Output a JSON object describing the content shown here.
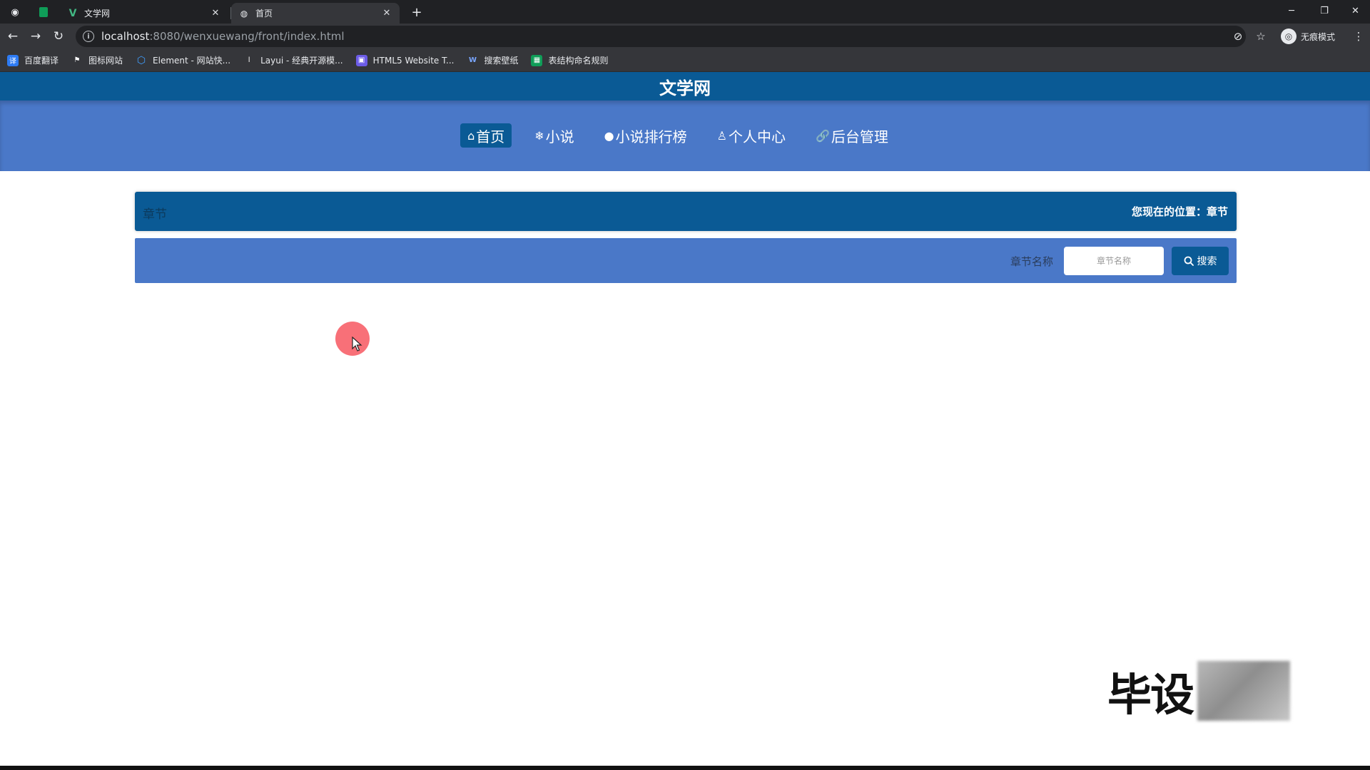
{
  "browser": {
    "tabs": [
      {
        "title": "文学网",
        "active": false
      },
      {
        "title": "首页",
        "active": true
      }
    ],
    "new_tab_label": "+",
    "url_host": "localhost",
    "url_rest": ":8080/wenxuewang/front/index.html",
    "profile_label": "无痕模式",
    "bookmarks": [
      {
        "label": "百度翻译",
        "color": "#2d7bf4",
        "glyph": "译"
      },
      {
        "label": "图标网站",
        "color": "#35363a",
        "glyph": "⚑"
      },
      {
        "label": "Element - 网站快...",
        "color": "#409eff",
        "glyph": "⬡"
      },
      {
        "label": "Layui - 经典开源模...",
        "color": "#35363a",
        "glyph": "l"
      },
      {
        "label": "HTML5 Website T...",
        "color": "#6c5ce7",
        "glyph": "▣"
      },
      {
        "label": "搜索壁纸",
        "color": "#35363a",
        "glyph": "W"
      },
      {
        "label": "表结构命名规则",
        "color": "#0f9d58",
        "glyph": "▦"
      }
    ]
  },
  "site": {
    "title": "文学网",
    "nav": [
      {
        "icon": "⌂",
        "icon_name": "home-icon",
        "label": "首页",
        "active": true
      },
      {
        "icon": "❄",
        "icon_name": "snowflake-icon",
        "label": "小说",
        "active": false
      },
      {
        "icon": "●",
        "icon_name": "globe-icon",
        "label": "小说排行榜",
        "active": false
      },
      {
        "icon": "♙",
        "icon_name": "user-icon",
        "label": "个人中心",
        "active": false
      },
      {
        "icon": "🔗",
        "icon_name": "link-icon",
        "label": "后台管理",
        "active": false
      }
    ],
    "breadcrumb": {
      "left": "章节",
      "right": "您现在的位置：章节"
    },
    "search": {
      "label": "章节名称",
      "placeholder": "章节名称",
      "value": "",
      "button": "搜索"
    }
  },
  "watermark": {
    "text": "毕设"
  },
  "colors": {
    "header": "#0a5a95",
    "nav_band": "#4a78c8",
    "active": "#0a5a95"
  }
}
